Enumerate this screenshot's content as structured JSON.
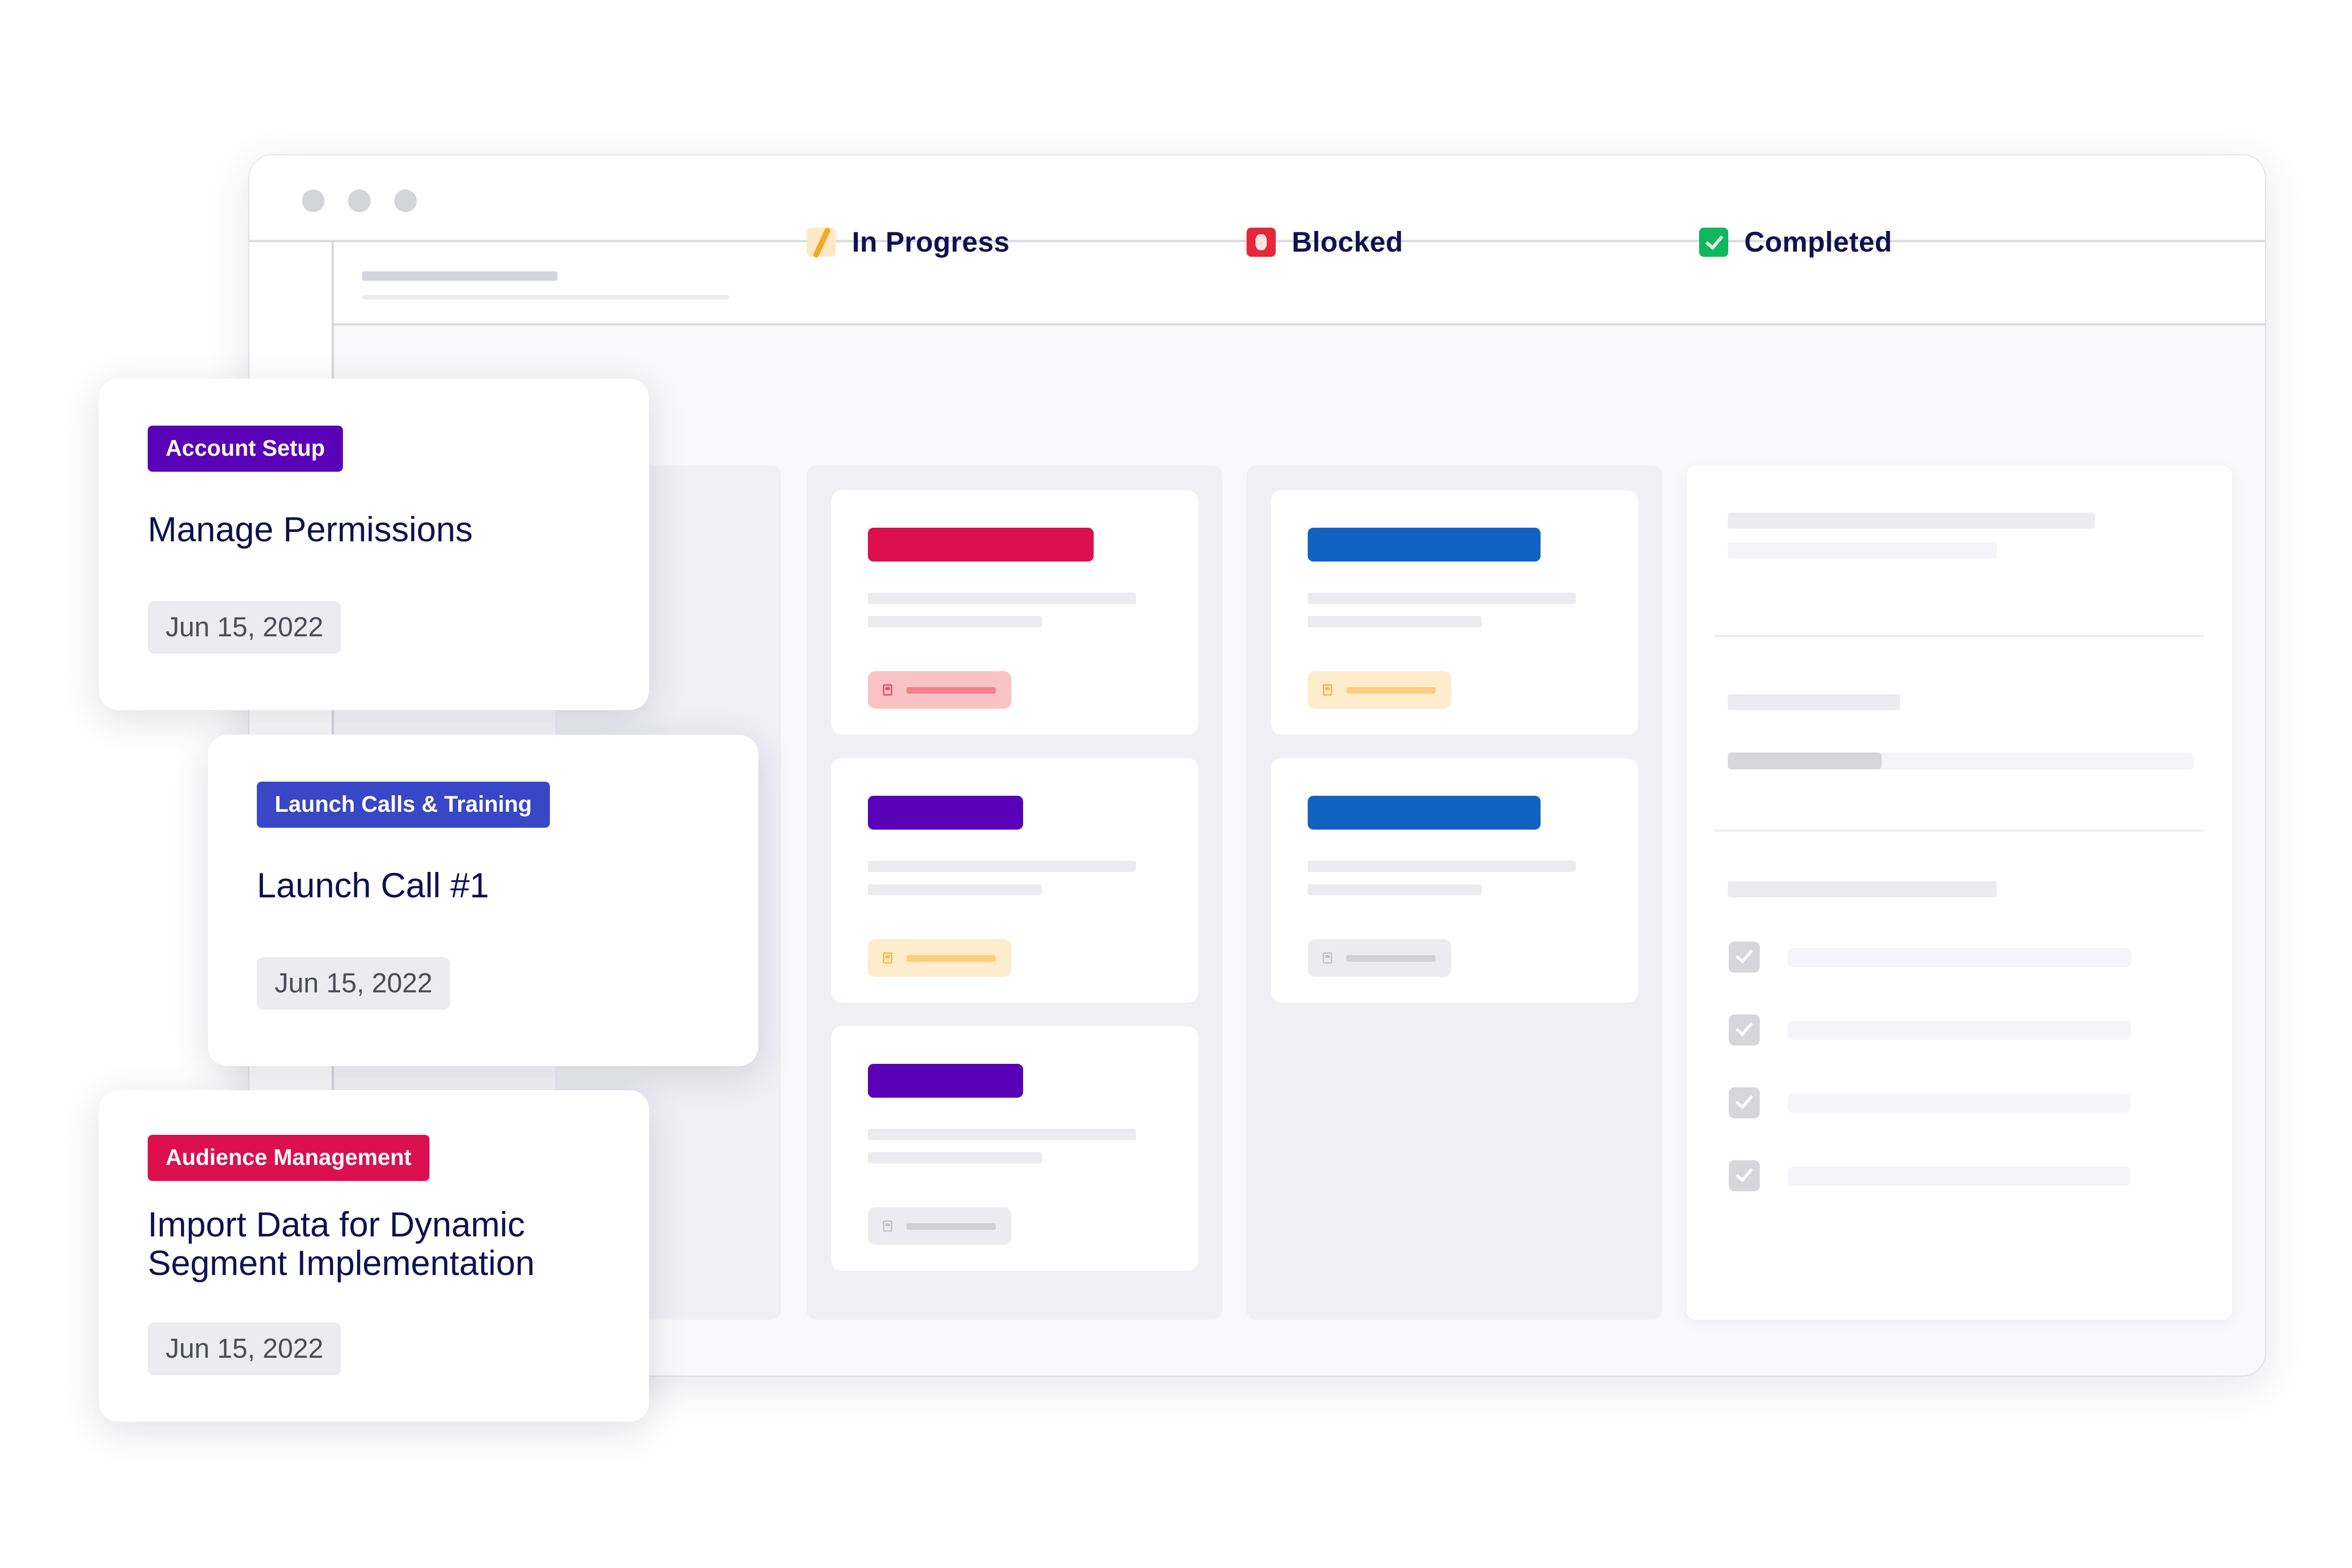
{
  "window": {
    "traffic_lights": [
      "window-dot-1",
      "window-dot-2",
      "window-dot-3"
    ]
  },
  "columns": [
    {
      "label": "In Progress",
      "icon": "pencil-icon",
      "icon_color": "#F7A823"
    },
    {
      "label": "Blocked",
      "icon": "blocked-stop-icon",
      "icon_color": "#E5283A"
    },
    {
      "label": "Completed",
      "icon": "checkbox-checked-icon",
      "icon_color": "#12B65B"
    }
  ],
  "lanes": {
    "in_progress": [
      {
        "tag_color": "#DC0F4F",
        "due_chip": "overdue",
        "chip_bg": "#F9C3C6",
        "chip_fg": "#F1495D"
      },
      {
        "tag_color": "#5A02B8",
        "due_chip": "due-soon",
        "chip_bg": "#FEECCD",
        "chip_fg": "#F7B544"
      },
      {
        "tag_color": "#5A02B8",
        "due_chip": "neutral",
        "chip_bg": "#EBEBF0",
        "chip_fg": "#C4C4CC"
      }
    ],
    "blocked": [
      {
        "tag_color": "#1263C1",
        "due_chip": "due-soon",
        "chip_bg": "#FEECCD",
        "chip_fg": "#F7B544"
      },
      {
        "tag_color": "#1263C1",
        "due_chip": "neutral",
        "chip_bg": "#EBEBF0",
        "chip_fg": "#C4C4CC"
      }
    ],
    "completed": {
      "progress_fraction": 0.33,
      "checklist": [
        {
          "checked": true
        },
        {
          "checked": true
        },
        {
          "checked": true
        },
        {
          "checked": true
        }
      ]
    }
  },
  "floating_cards": [
    {
      "category": "Account Setup",
      "category_color": "#5A02B8",
      "title": "Manage Permissions",
      "date": "Jun 15, 2022"
    },
    {
      "category": "Launch Calls & Training",
      "category_color": "#3847C6",
      "title": "Launch Call #1",
      "date": "Jun 15, 2022"
    },
    {
      "category": "Audience Management",
      "category_color": "#DC0F4F",
      "title": "Import Data for Dynamic Segment Implementation",
      "date": "Jun 15, 2022"
    }
  ],
  "colors": {
    "heading": "#10124F",
    "lane_bg": "#EFEFF4",
    "board_bg": "#F9F9FB"
  }
}
